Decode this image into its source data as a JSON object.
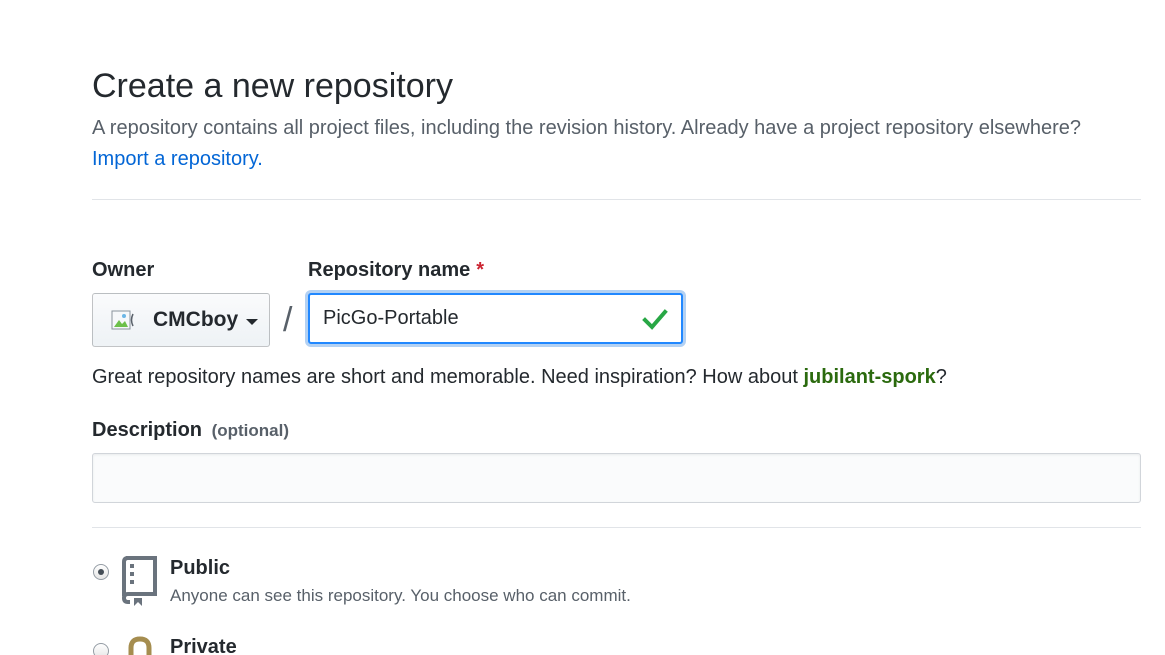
{
  "header": {
    "title": "Create a new repository",
    "subtitle": "A repository contains all project files, including the revision history. Already have a project repository elsewhere?",
    "import_link": "Import a repository."
  },
  "owner": {
    "label": "Owner",
    "selected": "CMCboy",
    "avatar_alt": "@CMCboy"
  },
  "separator": "/",
  "repo_name": {
    "label": "Repository name",
    "required_mark": "*",
    "value": "PicGo-Portable",
    "valid": true
  },
  "hint": {
    "text_before": "Great repository names are short and memorable. Need inspiration? How about ",
    "suggestion": "jubilant-spork",
    "text_after": "?"
  },
  "description": {
    "label": "Description",
    "optional_label": "(optional)",
    "value": ""
  },
  "visibility": {
    "public": {
      "title": "Public",
      "desc": "Anyone can see this repository. You choose who can commit.",
      "checked": true,
      "icon": "repo-book-icon"
    },
    "private": {
      "title": "Private",
      "checked": false,
      "icon": "lock-icon"
    }
  },
  "colors": {
    "link": "#0366d6",
    "focus_border": "#2188ff",
    "check": "#28a745",
    "required": "#cb2431",
    "suggestion": "#2b6a0e"
  }
}
